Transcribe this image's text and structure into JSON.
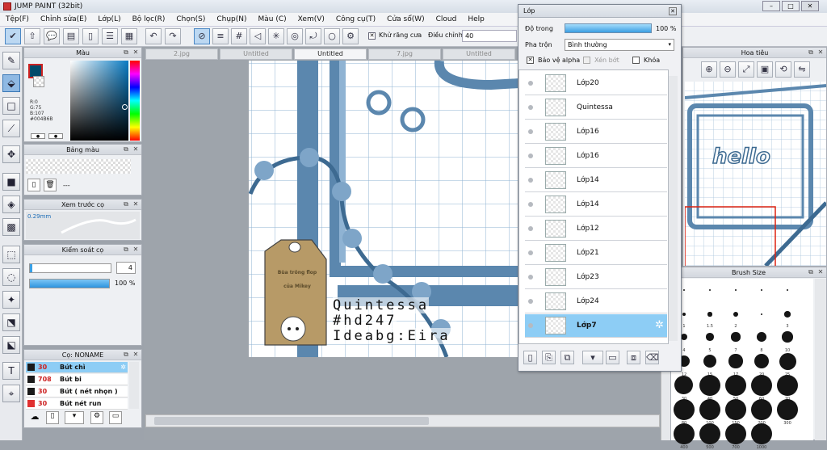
{
  "window": {
    "title": "JUMP PAINT (32bit)",
    "controls": [
      "–",
      "□",
      "✕"
    ]
  },
  "menu": [
    "Tệp(F)",
    "Chỉnh sửa(E)",
    "Lớp(L)",
    "Bộ lọc(R)",
    "Chọn(S)",
    "Chụp(N)",
    "Màu (C)",
    "Xem(V)",
    "Công cụ(T)",
    "Cửa sổ(W)",
    "Cloud",
    "Help"
  ],
  "toolbar": {
    "antialias_label": "Khử răng cưa",
    "adjust_label": "Điều chỉnh",
    "adjust_value": "40"
  },
  "color_panel": {
    "title": "Màu",
    "r": "R:0",
    "g": "G:75",
    "b": "B:107",
    "hex": "#004B6B",
    "main_color": "#004b6b"
  },
  "swatch_panel": {
    "title": "Bảng màu",
    "dash": "---"
  },
  "brush_preview": {
    "title": "Xem trước cọ",
    "size": "0.29mm"
  },
  "brush_control": {
    "title": "Kiểm soát cọ",
    "size_value": "4",
    "opacity_value": "100 %",
    "opacity_fraction": 1.0
  },
  "brush_list": {
    "title": "Cọ: NONAME",
    "items": [
      {
        "size": "30",
        "name": "Bút chì",
        "selected": true,
        "color": "#1a1a1a"
      },
      {
        "size": "708",
        "name": "Bút bi",
        "selected": false,
        "color": "#1a1a1a"
      },
      {
        "size": "30",
        "name": "Bút ( nét nhọn )",
        "selected": false,
        "color": "#1a1a1a"
      },
      {
        "size": "30",
        "name": "Bút nét run",
        "selected": false,
        "color": "#e03030"
      }
    ]
  },
  "doc_tabs": [
    "2.jpg",
    "Untitled",
    "Untitled",
    "7.jpg",
    "Untitled"
  ],
  "artwork": {
    "tag_line1": "Bùa trông flop",
    "tag_line2": "của Mikey",
    "text1": "Quintessa",
    "text2": "#hd247",
    "text3": "Ideabg:Eira",
    "accent": "#5b87ae"
  },
  "layer_window": {
    "title": "Lớp",
    "opacity_label": "Độ trong",
    "opacity_value": "100 %",
    "opacity_fraction": 1.0,
    "blend_label": "Pha trộn",
    "blend_value": "Bình thường",
    "protect_alpha": "Bảo vệ alpha",
    "clip": "Xén bớt",
    "lock": "Khóa",
    "layers": [
      {
        "name": "Lớp20",
        "selected": false
      },
      {
        "name": "Quintessa",
        "selected": false
      },
      {
        "name": "Lớp16",
        "selected": false
      },
      {
        "name": "Lớp16",
        "selected": false
      },
      {
        "name": "Lớp14",
        "selected": false
      },
      {
        "name": "Lớp14",
        "selected": false
      },
      {
        "name": "Lớp12",
        "selected": false
      },
      {
        "name": "Lớp21",
        "selected": false
      },
      {
        "name": "Lớp23",
        "selected": false
      },
      {
        "name": "Lớp24",
        "selected": false
      },
      {
        "name": "Lớp7",
        "selected": true
      }
    ]
  },
  "navigator": {
    "title": "Hoa tiêu",
    "preview_text": "hello"
  },
  "brush_size": {
    "title": "Brush Size",
    "rows": [
      [
        "",
        "",
        "",
        "",
        ""
      ],
      [
        "1",
        "1.5",
        "2",
        "",
        "3"
      ],
      [
        "4",
        "5",
        "7",
        "8",
        "10"
      ],
      [
        "12",
        "15",
        "17",
        "20",
        "25"
      ],
      [
        "30",
        "40",
        "50",
        "60",
        "70"
      ],
      [
        "80",
        "100",
        "150",
        "200",
        "300"
      ],
      [
        "400",
        "500",
        "700",
        "1000"
      ]
    ]
  }
}
